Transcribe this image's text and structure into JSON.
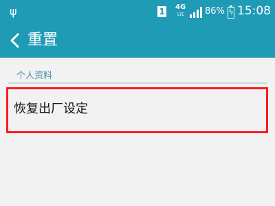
{
  "status_bar": {
    "sim_slot": "1",
    "network": "4G",
    "network_sub": "LTE",
    "battery": "86%",
    "time": "15:08",
    "icons": [
      "usb-icon",
      "sim-icon",
      "signal-icon",
      "battery-charging-icon"
    ]
  },
  "action_bar": {
    "back_icon": "chevron-left-icon",
    "title": "重置"
  },
  "section": {
    "header": "个人资料",
    "items": [
      {
        "label": "恢复出厂设定"
      }
    ]
  },
  "colors": {
    "header_bg": "#1f9bb6",
    "section_text": "#4a8da7",
    "highlight": "#ff1b1b"
  }
}
